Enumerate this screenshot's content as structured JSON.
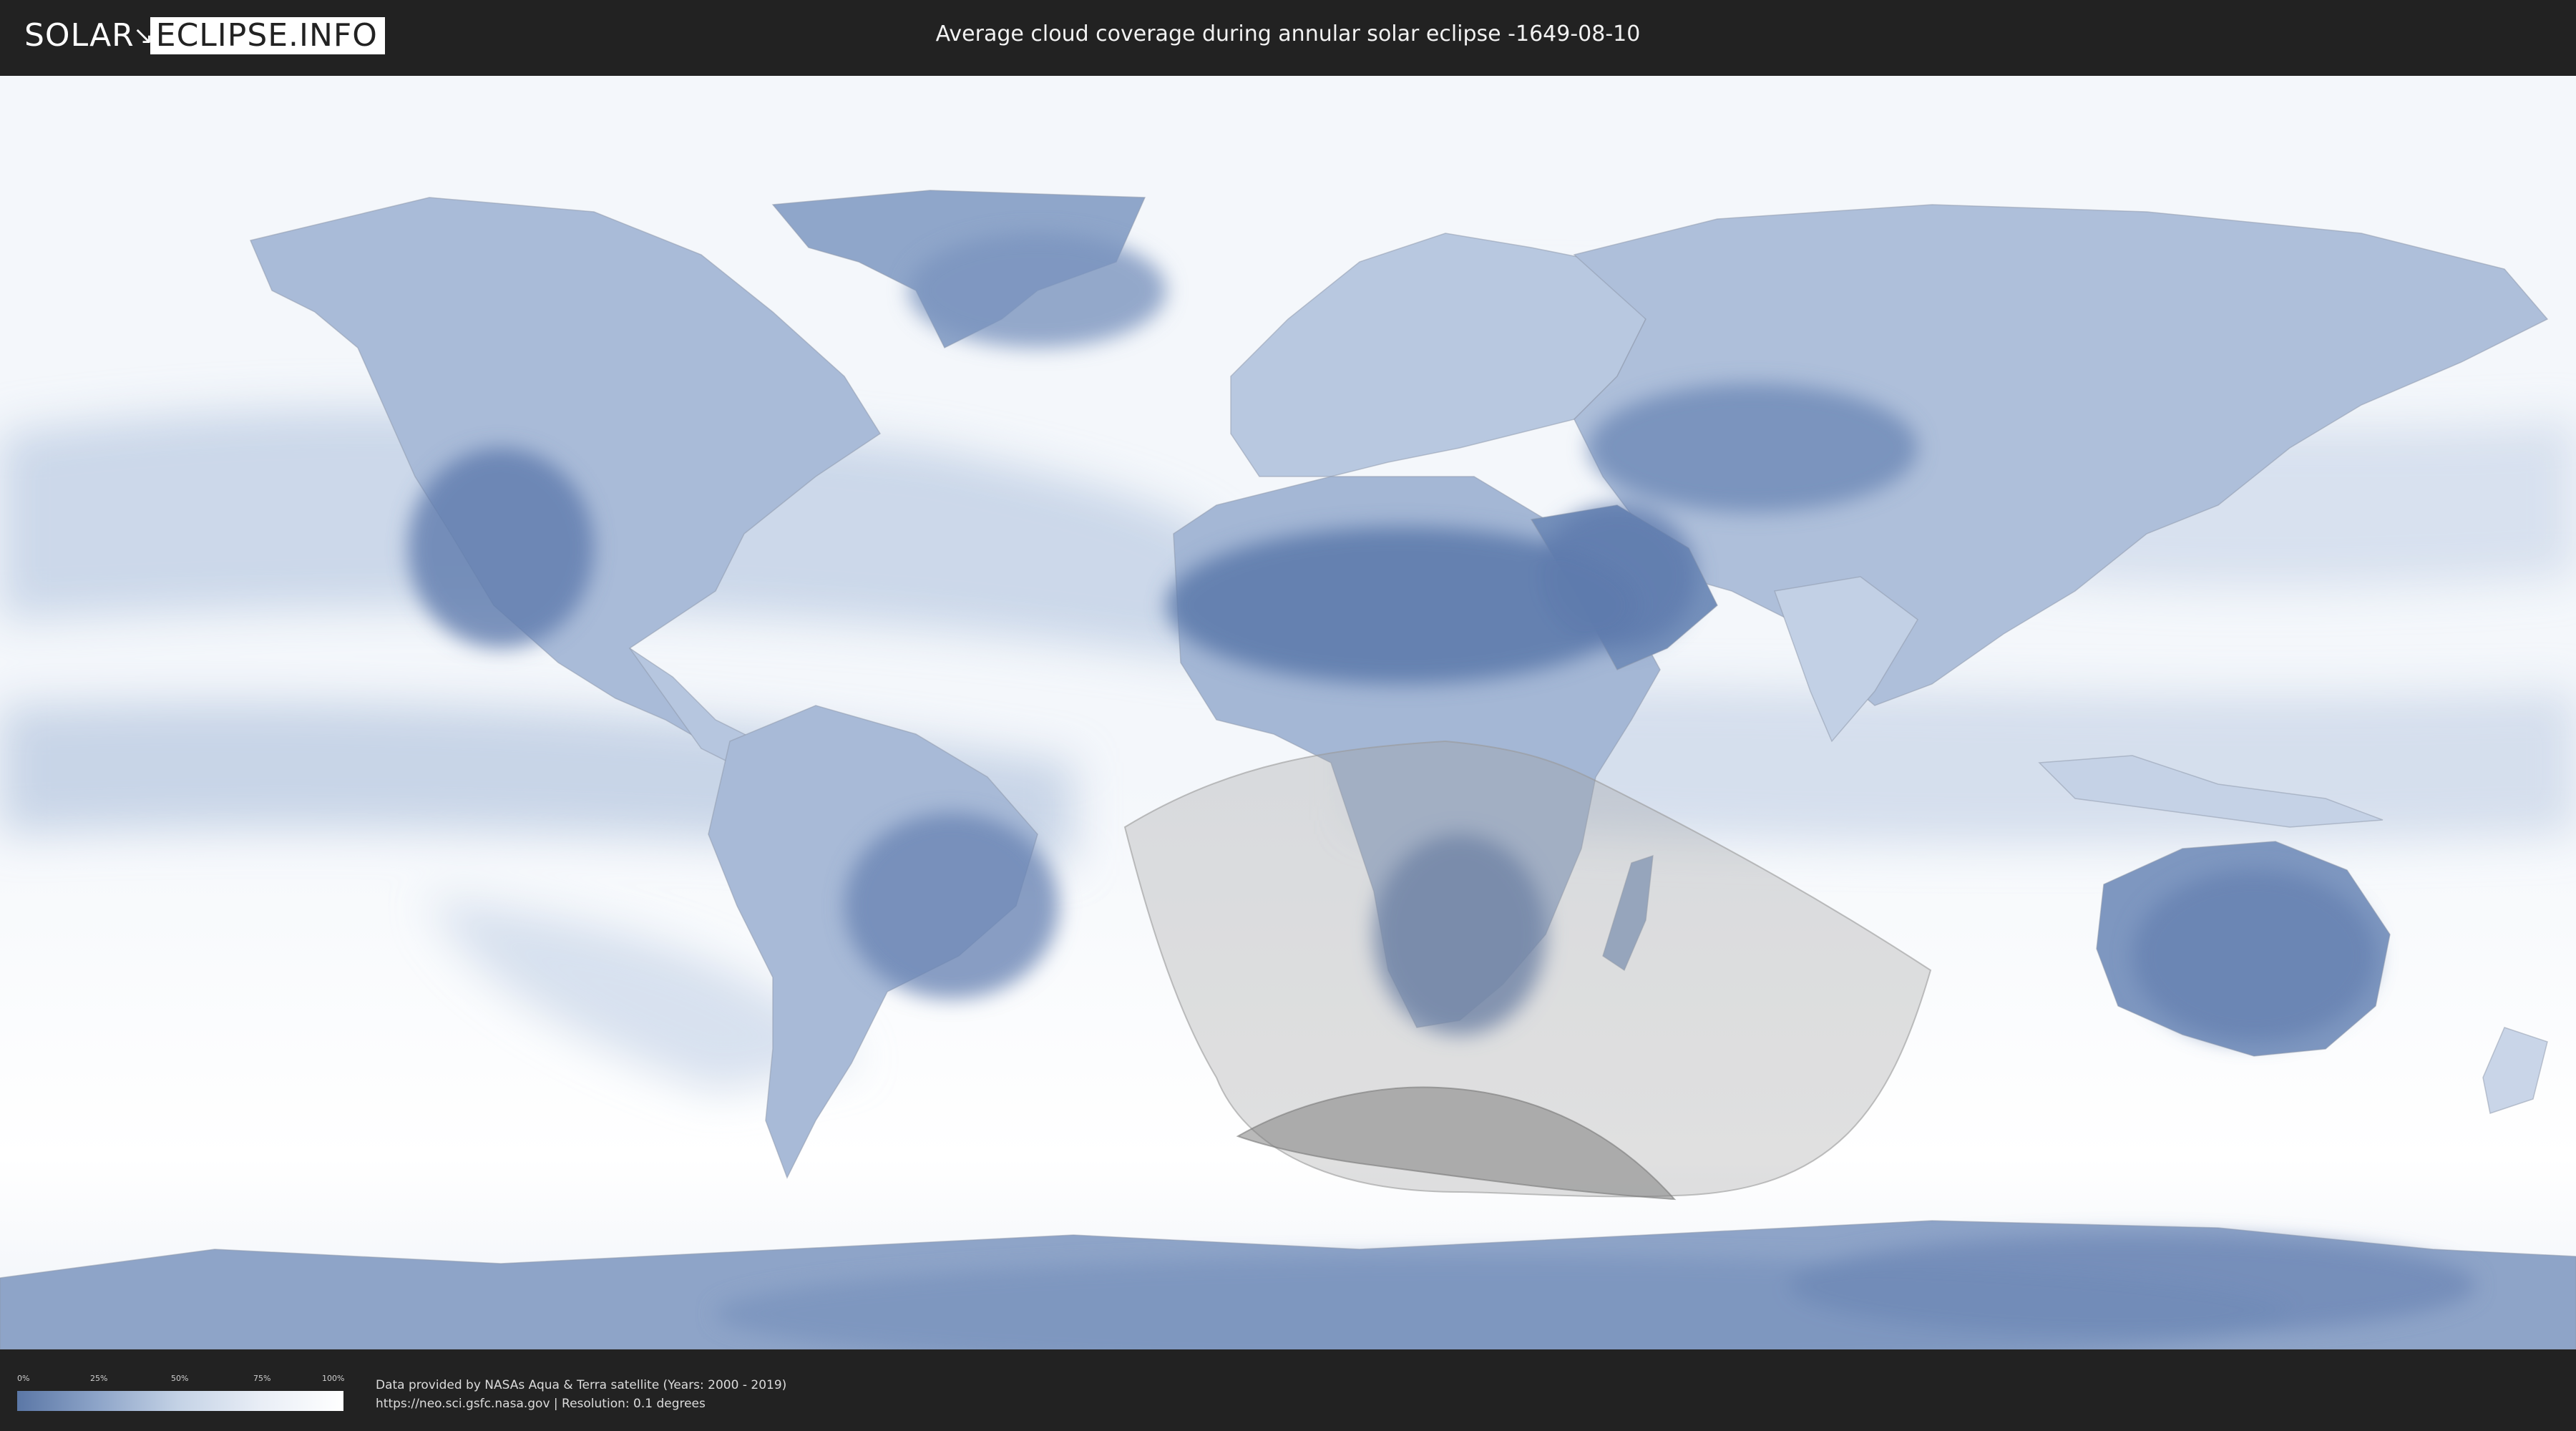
{
  "header": {
    "logo_left": "SOLAR",
    "logo_right": "ECLIPSE.INFO",
    "title": "Average cloud coverage during annular solar eclipse -1649-08-10"
  },
  "icons": {
    "logo_bolt": "lightning-bolt-icon"
  },
  "legend": {
    "ticks": [
      "0%",
      "25%",
      "50%",
      "75%",
      "100%"
    ],
    "colors": [
      "#5b77a6",
      "#8ea5c9",
      "#c5d3e6",
      "#e9eef6",
      "#ffffff"
    ]
  },
  "credits": {
    "line1": "Data provided by NASAs Aqua & Terra satellite (Years: 2000 - 2019)",
    "line2": "https://neo.sci.gsfc.nasa.gov | Resolution: 0.1 degrees"
  },
  "colors": {
    "land_cloudfree": "#6a85b2",
    "ocean_cloudy": "#f2f6fb",
    "eclipse_overlay": "#9e9e9e",
    "header_bg": "#222222"
  }
}
